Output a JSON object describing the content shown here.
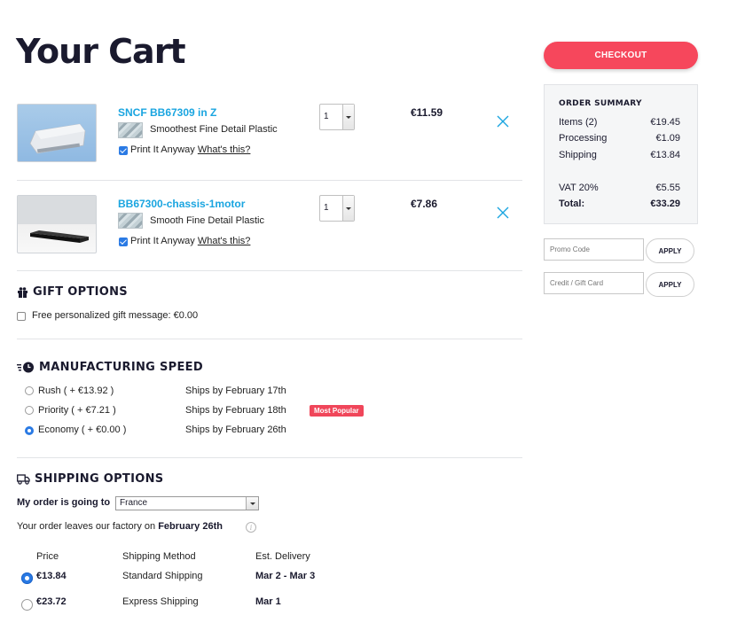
{
  "page": {
    "title": "Your Cart"
  },
  "cart": {
    "items": [
      {
        "name": "SNCF BB67309 in Z",
        "material": "Smoothest Fine Detail Plastic",
        "print_label": "Print It Anyway",
        "whats_label": "What's this?",
        "qty": "1",
        "price": "€11.59"
      },
      {
        "name": "BB67300-chassis-1motor",
        "material": "Smooth Fine Detail Plastic",
        "print_label": "Print It Anyway",
        "whats_label": "What's this?",
        "qty": "1",
        "price": "€7.86"
      }
    ]
  },
  "gift": {
    "title": "GIFT OPTIONS",
    "option_label": "Free personalized gift message: €0.00"
  },
  "manufacturing": {
    "title": "MANUFACTURING SPEED",
    "options": [
      {
        "label": "Rush ( + €13.92 )",
        "ships": "Ships by February 17th"
      },
      {
        "label": "Priority ( + €7.21 )",
        "ships": "Ships by February 18th",
        "badge": "Most Popular"
      },
      {
        "label": "Economy ( + €0.00 )",
        "ships": "Ships by February 26th"
      }
    ],
    "selected_index": 2
  },
  "shipping": {
    "title": "SHIPPING OPTIONS",
    "going_label": "My order is going to",
    "country": "France",
    "leaves_label": "Your order leaves our factory on",
    "leaves_date": "February 26th",
    "headers": {
      "price": "Price",
      "method": "Shipping Method",
      "delivery": "Est. Delivery"
    },
    "options": [
      {
        "price": "€13.84",
        "method": "Standard Shipping",
        "delivery": "Mar 2 - Mar 3"
      },
      {
        "price": "€23.72",
        "method": "Express Shipping",
        "delivery": "Mar 1"
      }
    ],
    "selected_index": 0
  },
  "checkout": {
    "label": "CHECKOUT"
  },
  "summary": {
    "title": "ORDER SUMMARY",
    "rows": [
      {
        "label": "Items (2)",
        "value": "€19.45"
      },
      {
        "label": "Processing",
        "value": "€1.09"
      },
      {
        "label": "Shipping",
        "value": "€13.84"
      },
      {
        "label": "VAT 20%",
        "value": "€5.55"
      },
      {
        "label": "Total:",
        "value": "€33.29"
      }
    ]
  },
  "promo": {
    "promo_placeholder": "Promo Code",
    "gift_placeholder": "Credit / Gift Card",
    "apply_label": "APPLY"
  },
  "colors": {
    "accent": "#f6475c",
    "link": "#1aa5e0",
    "radio": "#2a7ae4",
    "badge": "#f0465a"
  }
}
